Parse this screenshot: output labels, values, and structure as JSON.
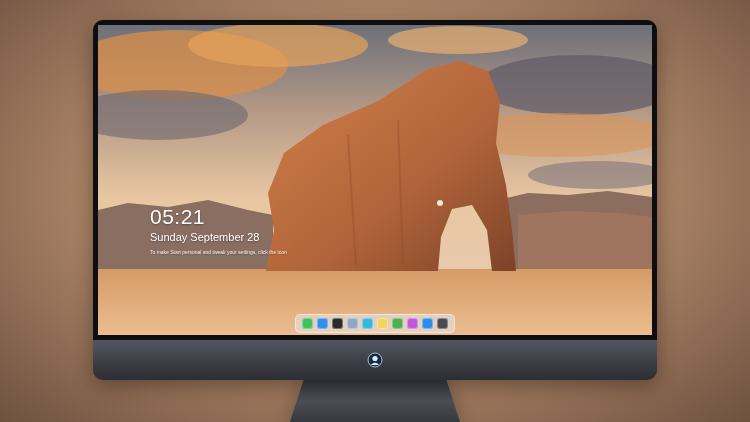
{
  "lock_screen": {
    "time": "05:21",
    "date": "Sunday September 28",
    "hint": "To make Start personal and tweak your settings, click the icon"
  },
  "dock": {
    "apps": [
      {
        "color": "#3fc35a"
      },
      {
        "color": "#2f8ff0"
      },
      {
        "color": "#2b2b2b"
      },
      {
        "color": "#8fa7c4"
      },
      {
        "color": "#37b6e0"
      },
      {
        "color": "#f4d35e"
      },
      {
        "color": "#4caf50"
      },
      {
        "color": "#c05ad8"
      },
      {
        "color": "#2d8cf0"
      },
      {
        "color": "#4a4a4f"
      }
    ]
  }
}
